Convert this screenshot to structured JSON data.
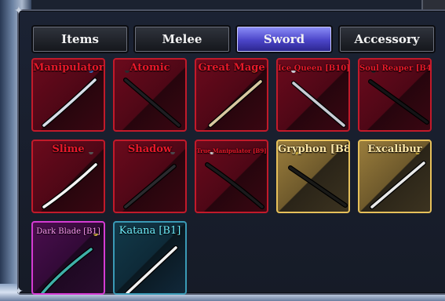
{
  "tabs": [
    {
      "label": "Items",
      "active": false
    },
    {
      "label": "Melee",
      "active": false
    },
    {
      "label": "Sword",
      "active": true
    },
    {
      "label": "Accessory",
      "active": false
    }
  ],
  "swords": [
    {
      "name": "Manipulator",
      "rarity": "red",
      "blade": "steel-curved",
      "icon": "sword-icon"
    },
    {
      "name": "Atomic",
      "rarity": "red",
      "blade": "dark",
      "icon": "sword-icon"
    },
    {
      "name": "Great Mage",
      "rarity": "red",
      "blade": "rapier-gold",
      "icon": "rapier-icon"
    },
    {
      "name": "Ice Queen [B10]",
      "rarity": "red",
      "blade": "scepter",
      "icon": "scepter-icon"
    },
    {
      "name": "Soul Reaper [B4]",
      "rarity": "red",
      "blade": "dark-staff",
      "icon": "staff-icon"
    },
    {
      "name": "Slime",
      "rarity": "red",
      "blade": "katana-white",
      "icon": "sword-icon"
    },
    {
      "name": "Shadow",
      "rarity": "red",
      "blade": "dark-broad",
      "icon": "sword-icon"
    },
    {
      "name": "True Manipulator [B9]",
      "rarity": "red",
      "blade": "katana-dark",
      "icon": "sword-icon"
    },
    {
      "name": "Gryphon [B8]",
      "rarity": "gold",
      "blade": "gold-rapier",
      "icon": "rapier-icon"
    },
    {
      "name": "Excalibur",
      "rarity": "gold",
      "blade": "holy",
      "icon": "sword-icon"
    },
    {
      "name": "Dark Blade [B1]",
      "rarity": "purple",
      "blade": "teal-curved",
      "icon": "sword-icon"
    },
    {
      "name": "Katana [B1]",
      "rarity": "teal",
      "blade": "katana",
      "icon": "katana-icon"
    }
  ]
}
